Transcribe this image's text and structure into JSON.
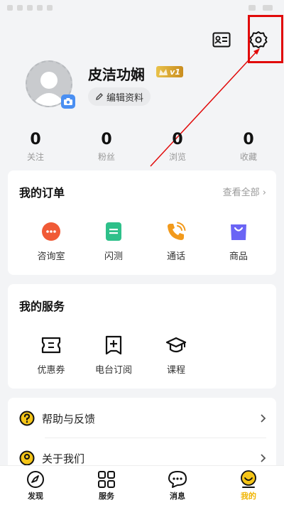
{
  "profile": {
    "name": "皮洁功娴",
    "vip_level": "v1",
    "edit_label": "编辑资料"
  },
  "stats": [
    {
      "value": "0",
      "label": "关注"
    },
    {
      "value": "0",
      "label": "粉丝"
    },
    {
      "value": "0",
      "label": "浏览"
    },
    {
      "value": "0",
      "label": "收藏"
    }
  ],
  "orders": {
    "title": "我的订单",
    "more": "查看全部",
    "items": [
      {
        "label": "咨询室",
        "icon": "chat-bubble-icon",
        "color": "#f05a36"
      },
      {
        "label": "闪测",
        "icon": "document-icon",
        "color": "#2ec08a"
      },
      {
        "label": "通话",
        "icon": "phone-icon",
        "color": "#f29a1c"
      },
      {
        "label": "商品",
        "icon": "shopping-bag-icon",
        "color": "#6a64f5"
      }
    ]
  },
  "services": {
    "title": "我的服务",
    "items": [
      {
        "label": "优惠券",
        "icon": "ticket-icon"
      },
      {
        "label": "电台订阅",
        "icon": "add-box-icon"
      },
      {
        "label": "课程",
        "icon": "graduation-cap-icon"
      }
    ]
  },
  "list": [
    {
      "label": "帮助与反馈",
      "icon": "question-circle-icon"
    },
    {
      "label": "关于我们",
      "icon": "info-icon"
    }
  ],
  "tabbar": [
    {
      "label": "发现",
      "icon": "compass-icon"
    },
    {
      "label": "服务",
      "icon": "grid-icon"
    },
    {
      "label": "消息",
      "icon": "message-icon"
    },
    {
      "label": "我的",
      "icon": "profile-icon",
      "active": true
    }
  ],
  "colors": {
    "accent": "#f0b400",
    "highlight_box": "#e10a0a",
    "background": "#f3f4f6"
  }
}
